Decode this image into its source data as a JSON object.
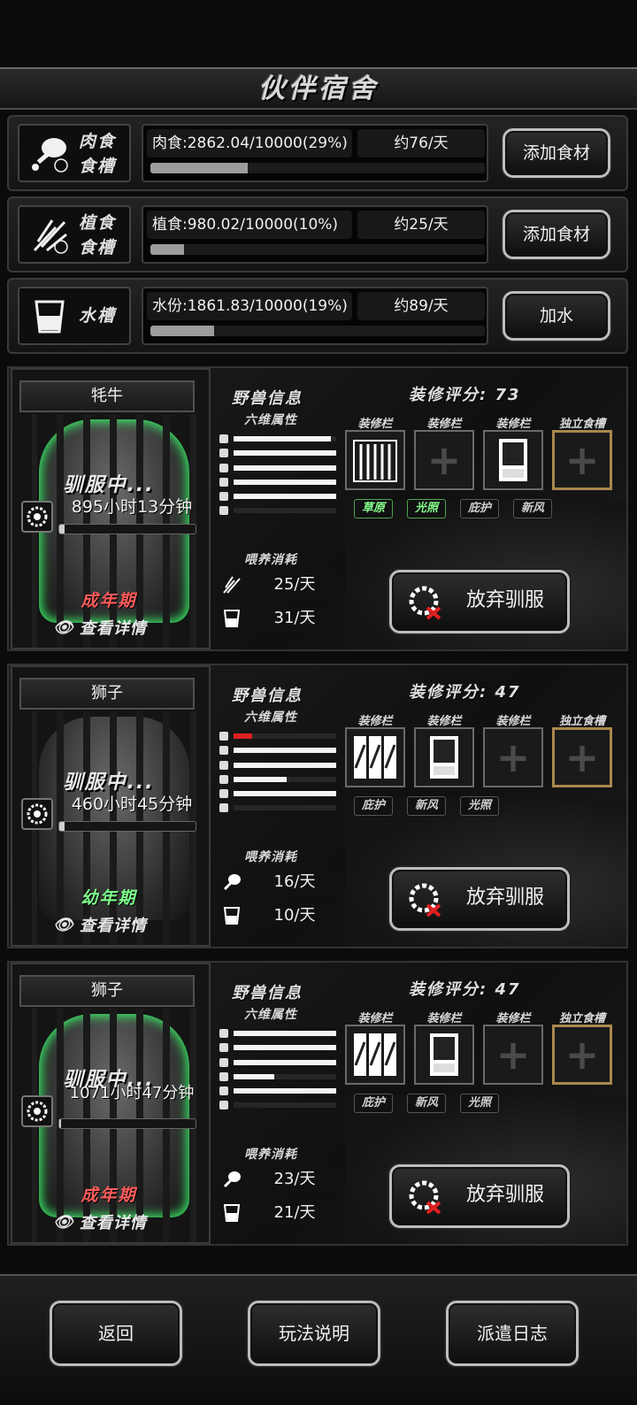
{
  "title": "伙伴宿舍",
  "troughs": [
    {
      "name": "肉食\n食槽",
      "line1": "肉食",
      "line2": "食槽",
      "amount": "肉食:2862.04/10000(29%)",
      "rate": "约76/天",
      "fill": 0.29,
      "button": "添加食材"
    },
    {
      "name": "植食食槽",
      "line1": "植食",
      "line2": "食槽",
      "amount": "植食:980.02/10000(10%)",
      "rate": "约25/天",
      "fill": 0.1,
      "button": "添加食材"
    },
    {
      "name": "水槽",
      "line1": "水槽",
      "line2": "",
      "amount": "水份:1861.83/10000(19%)",
      "rate": "约89/天",
      "fill": 0.19,
      "button": "加水"
    }
  ],
  "labels": {
    "beast_info": "野兽信息",
    "six_attrs": "六维属性",
    "feed_cost": "喂养消耗",
    "deco_slot": "装修栏",
    "own_trough": "独立食槽",
    "taming": "驯服中...",
    "view_detail": "查看详情",
    "abandon": "放弃驯服"
  },
  "animals": [
    {
      "name": "牦牛",
      "score": "装修评分: 73",
      "time": "895小时13分钟",
      "time_progress": 0.03,
      "stage": "成年期",
      "stage_color": "#ff5b5b",
      "attrs": [
        0.95,
        1.0,
        1.0,
        1.0,
        1.0,
        0.0
      ],
      "tags": [
        "草原",
        "光照",
        "庇护",
        "新风"
      ],
      "tags_active": [
        true,
        true,
        false,
        false
      ],
      "feed": [
        {
          "icon": "plant-icon",
          "value": "25/天"
        },
        {
          "icon": "water-icon",
          "value": "31/天"
        }
      ]
    },
    {
      "name": "狮子",
      "score": "装修评分: 47",
      "time": "460小时45分钟",
      "time_progress": 0.03,
      "stage": "幼年期",
      "stage_color": "#7dff8a",
      "attrs": [
        0.2,
        1.0,
        1.0,
        0.52,
        1.0,
        0.0
      ],
      "tags": [
        "庇护",
        "新风",
        "光照"
      ],
      "tags_active": [
        false,
        false,
        false
      ],
      "feed": [
        {
          "icon": "meat-icon",
          "value": "16/天"
        },
        {
          "icon": "water-icon",
          "value": "10/天"
        }
      ]
    },
    {
      "name": "狮子",
      "score": "装修评分: 47",
      "time": "1071小时47分钟",
      "time_progress": 0.01,
      "stage": "成年期",
      "stage_color": "#ff5b5b",
      "attrs": [
        1.0,
        1.0,
        1.0,
        0.4,
        1.0,
        0.0
      ],
      "tags": [
        "庇护",
        "新风",
        "光照"
      ],
      "tags_active": [
        false,
        false,
        false
      ],
      "feed": [
        {
          "icon": "meat-icon",
          "value": "23/天"
        },
        {
          "icon": "water-icon",
          "value": "21/天"
        }
      ]
    }
  ],
  "bottom": {
    "back": "返回",
    "help": "玩法说明",
    "log": "派遣日志"
  }
}
